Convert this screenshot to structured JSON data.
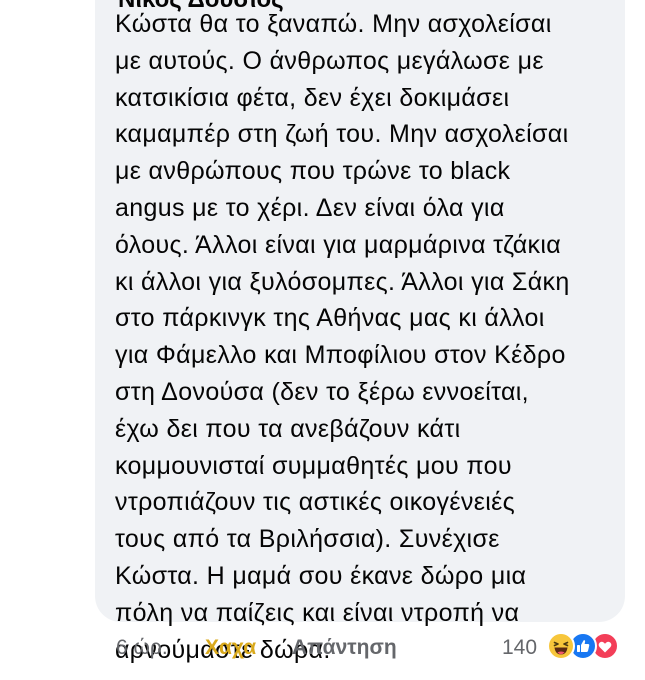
{
  "comment": {
    "author": "Νίκος Δούσιος",
    "lines": [
      "Κώστα θα το ξαναπώ. Μην ασχολείσαι",
      "με αυτούς. Ο άνθρωπος μεγάλωσε με",
      "κατσικίσια φέτα, δεν έχει δοκιμάσει",
      "καμαμπέρ στη ζωή του. Μην ασχολείσαι",
      "με ανθρώπους που τρώνε το black",
      "angus με το χέρι. Δεν είναι όλα για",
      "όλους. Άλλοι είναι για μαρμάρινα τζάκια",
      "κι άλλοι για ξυλόσομπες. Άλλοι για Σάκη",
      "στο πάρκινγκ της Αθήνας μας κι άλλοι",
      "για Φάμελλο και Μποφίλιου στον Κέδρο",
      "στη Δονούσα (δεν το ξέρω εννοείται,",
      "έχω δει που τα ανεβάζουν κάτι",
      "κομμουνισταί συμμαθητές μου που",
      "ντροπιάζουν τις αστικές οικογένειές",
      "τους από τα Βριλήσσια). Συνέχισε",
      "Κώστα. Η μαμά σου έκανε δώρο μια",
      "πόλη να παίζεις και είναι ντροπή να",
      "αρνούμαστε δώρα."
    ]
  },
  "actions": {
    "time": "6 ώρ.",
    "haha_label": "Χαχα",
    "reply_label": "Απάντηση",
    "reaction_count": "140",
    "reaction_icons": [
      "haha-icon",
      "like-icon",
      "love-icon"
    ]
  },
  "colors": {
    "bubble": "#f0f2f5",
    "haha": "#d9a91c",
    "like": "#1877f2",
    "love": "#f33e58",
    "meta": "#65676b"
  }
}
